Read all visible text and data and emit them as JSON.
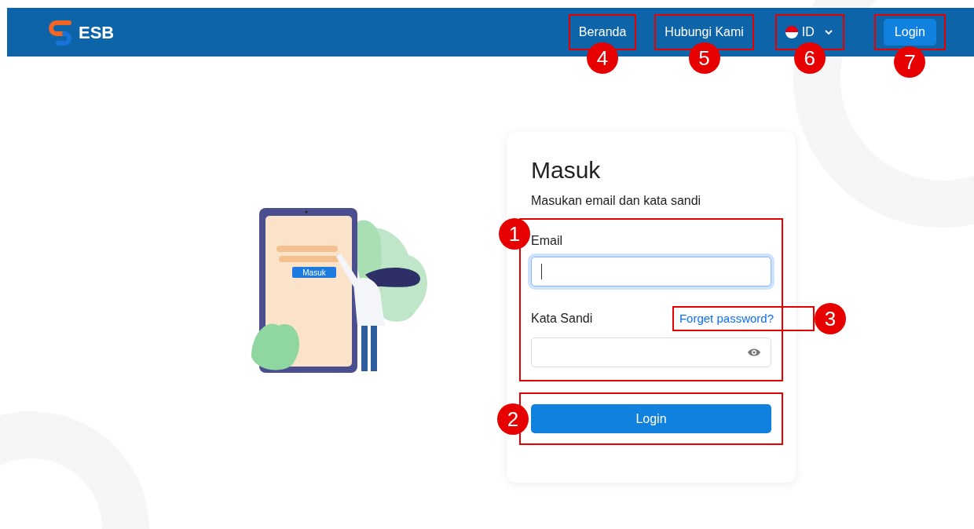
{
  "header": {
    "logo": "ESB",
    "nav": [
      {
        "label": "Beranda",
        "callout": "4"
      },
      {
        "label": "Hubungi Kami",
        "callout": "5"
      }
    ],
    "language": {
      "label": "ID",
      "callout": "6"
    },
    "login_button": {
      "label": "Login",
      "callout": "7"
    }
  },
  "illustration": {
    "button_label": "Masuk"
  },
  "login_card": {
    "title": "Masuk",
    "subtitle": "Masukan email dan kata sandi",
    "fields_callout": "1",
    "email": {
      "label": "Email",
      "focused": true
    },
    "password": {
      "label": "Kata Sandi",
      "focused": false
    },
    "forgot_link": {
      "label": "Forget password?",
      "callout": "3"
    },
    "submit": {
      "label": "Login",
      "callout": "2"
    }
  }
}
